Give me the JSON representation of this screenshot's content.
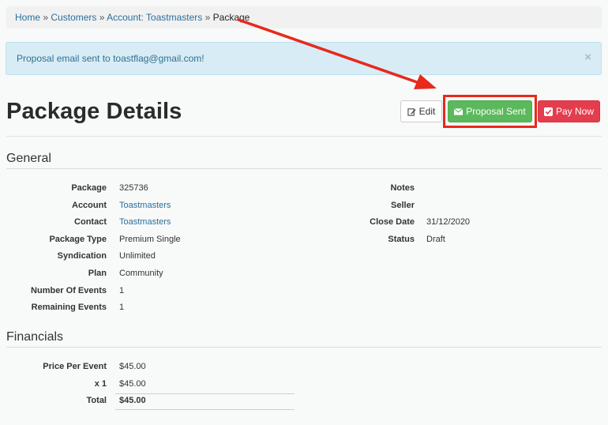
{
  "breadcrumb": {
    "items": [
      "Home",
      "Customers",
      "Account: Toastmasters"
    ],
    "separator": "»",
    "current": "Package"
  },
  "alert": {
    "message": "Proposal email sent to toastflag@gmail.com!",
    "close": "×"
  },
  "page": {
    "title": "Package Details"
  },
  "actions": {
    "edit_label": "Edit",
    "proposal_label": "Proposal Sent",
    "pay_label": "Pay Now"
  },
  "general": {
    "title": "General",
    "left": [
      {
        "label": "Package",
        "value": "325736"
      },
      {
        "label": "Account",
        "value": "Toastmasters"
      },
      {
        "label": "Contact",
        "value": "Toastmasters"
      },
      {
        "label": "Package Type",
        "value": "Premium Single"
      },
      {
        "label": "Syndication",
        "value": "Unlimited"
      },
      {
        "label": "Plan",
        "value": "Community"
      },
      {
        "label": "Number Of Events",
        "value": "1"
      },
      {
        "label": "Remaining Events",
        "value": "1"
      }
    ],
    "right": [
      {
        "label": "Notes",
        "value": ""
      },
      {
        "label": "Seller",
        "value": ""
      },
      {
        "label": "Close Date",
        "value": "31/12/2020"
      },
      {
        "label": "Status",
        "value": "Draft"
      }
    ]
  },
  "financials": {
    "title": "Financials",
    "rows": [
      {
        "label": "Price Per Event",
        "value": "$45.00"
      },
      {
        "label": "x 1",
        "value": "$45.00"
      },
      {
        "label": "Total",
        "value": "$45.00"
      }
    ]
  },
  "colors": {
    "link": "#2a6f9c",
    "success": "#5cb85c",
    "danger": "#e43d4d",
    "alert_bg": "#d8ecf6",
    "annotation": "#e8291c"
  },
  "icons": {
    "edit": "edit-icon",
    "proposal": "envelope-icon",
    "pay": "check-square-icon"
  }
}
